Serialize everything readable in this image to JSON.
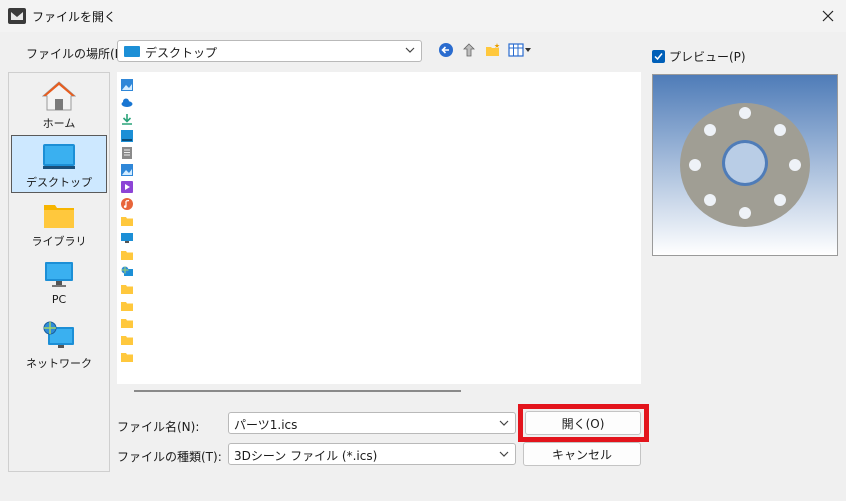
{
  "window": {
    "title": "ファイルを開く"
  },
  "toolbar": {
    "lookin_label": "ファイルの場所(I):",
    "lookin_value": "デスクトップ"
  },
  "places": [
    {
      "label": "ホーム",
      "icon": "home-icon"
    },
    {
      "label": "デスクトップ",
      "icon": "desktop-icon",
      "selected": true
    },
    {
      "label": "ライブラリ",
      "icon": "library-folder-icon"
    },
    {
      "label": "PC",
      "icon": "pc-monitor-icon"
    },
    {
      "label": "ネットワーク",
      "icon": "network-icon"
    }
  ],
  "preview": {
    "label": "プレビュー(P)",
    "checked": true
  },
  "form": {
    "filename_label": "ファイル名(N):",
    "filename_value": "パーツ1.ics",
    "filetype_label": "ファイルの種類(T):",
    "filetype_value": "3Dシーン ファイル (*.ics)"
  },
  "buttons": {
    "open": "開く(O)",
    "cancel": "キャンセル"
  },
  "colors": {
    "accent": "#005fb8",
    "highlight": "#e3141c",
    "folder": "#ffc83d"
  }
}
